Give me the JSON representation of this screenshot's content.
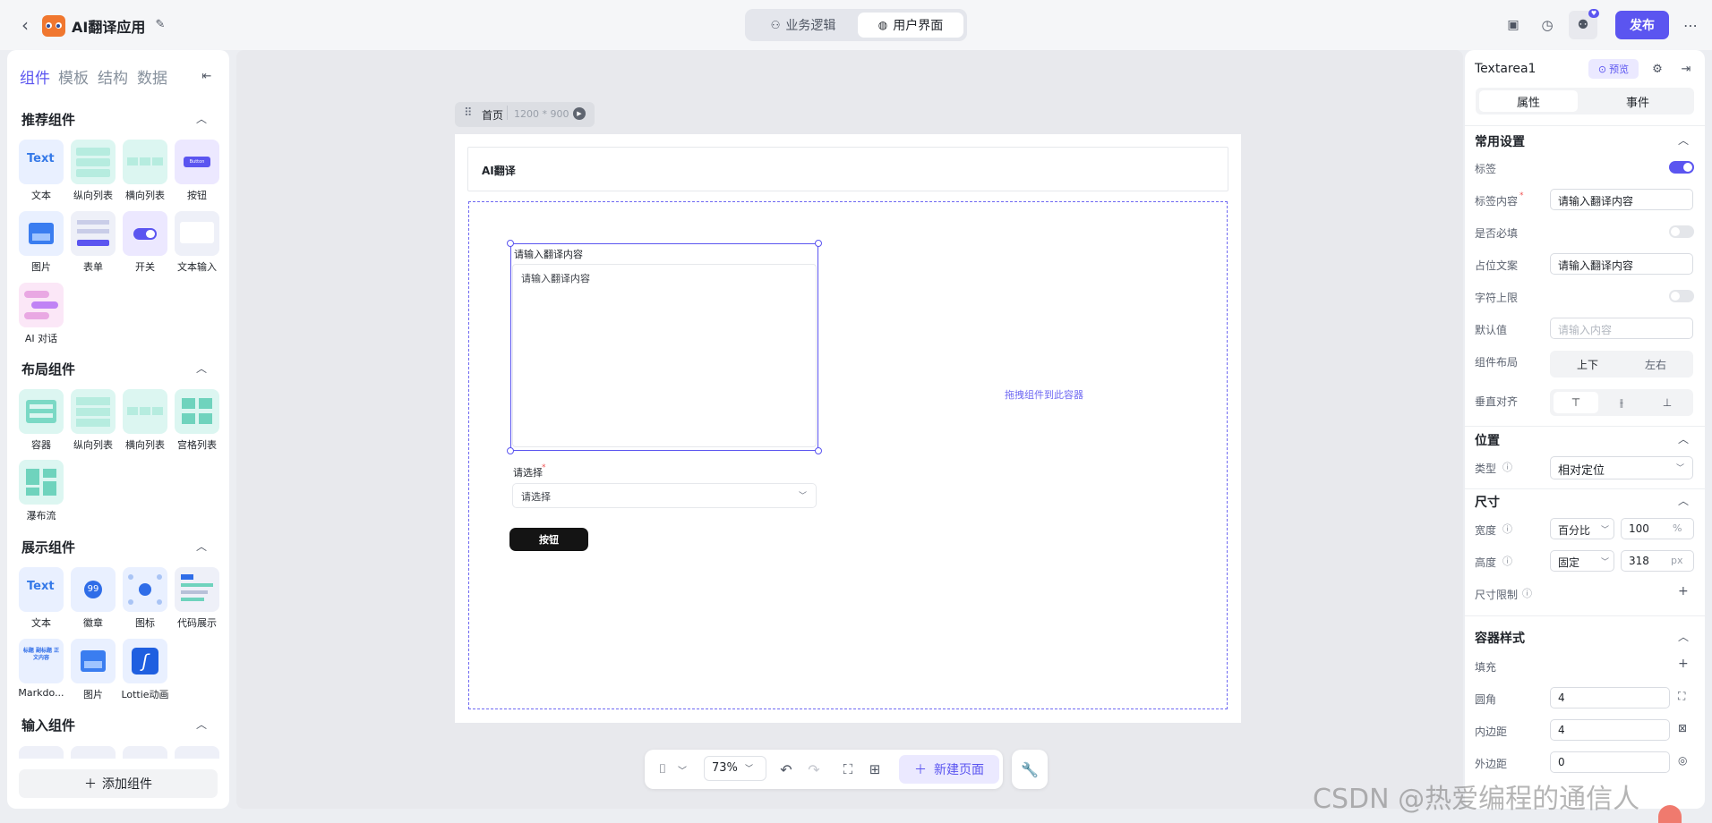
{
  "app": {
    "title": "AI翻译应用"
  },
  "header": {
    "tabs": [
      {
        "label": "业务逻辑"
      },
      {
        "label": "用户界面"
      }
    ],
    "publish_label": "发布",
    "badge": "♥"
  },
  "sidebar": {
    "categories": [
      "组件",
      "模板",
      "结构",
      "数据"
    ],
    "sections": {
      "recommended": "推荐组件",
      "layout": "布局组件",
      "display": "展示组件",
      "input": "输入组件"
    },
    "recommended": [
      "文本",
      "纵向列表",
      "横向列表",
      "按钮",
      "图片",
      "表单",
      "开关",
      "文本输入",
      "AI 对话"
    ],
    "layout": [
      "容器",
      "纵向列表",
      "横向列表",
      "宫格列表",
      "瀑布流"
    ],
    "display": [
      "文本",
      "徽章",
      "图标",
      "代码展示",
      "Markdo...",
      "图片",
      "Lottie动画"
    ],
    "thumb_text": {
      "text": "Text",
      "badge": "99",
      "button": "Button",
      "md": "标题 副标题 正文内容"
    },
    "add_label": "添加组件"
  },
  "canvas": {
    "page_name": "首页",
    "page_size": "1200 * 900",
    "title": "AI翻译",
    "textarea_label": "请输入翻译内容",
    "textarea_placeholder": "请输入翻译内容",
    "select_label": "请选择",
    "select_placeholder": "请选择",
    "required_mark": "*",
    "button_label": "按钮",
    "drop_hint": "拖拽组件到此容器",
    "zoom": "73%",
    "new_page": "新建页面"
  },
  "props": {
    "component": "Textarea1",
    "preview": "预览",
    "tabs": [
      "属性",
      "事件"
    ],
    "common": {
      "title": "常用设置",
      "label": "标签",
      "label_content": "标签内容",
      "label_content_value": "请输入翻译内容",
      "required": "是否必填",
      "placeholder": "占位文案",
      "placeholder_value": "请输入翻译内容",
      "maxlen": "字符上限",
      "default": "默认值",
      "default_ph": "请输入内容",
      "layout": "组件布局",
      "layout_opts": [
        "上下",
        "左右"
      ],
      "valign": "垂直对齐",
      "label_on": true,
      "required_on": false,
      "maxlen_on": false
    },
    "position": {
      "title": "位置",
      "type_label": "类型",
      "type_value": "相对定位"
    },
    "size": {
      "title": "尺寸",
      "width_label": "宽度",
      "width_mode": "百分比",
      "width_value": "100",
      "width_unit": "%",
      "height_label": "高度",
      "height_mode": "固定",
      "height_value": "318",
      "height_unit": "px",
      "limit_label": "尺寸限制"
    },
    "style": {
      "title": "容器样式",
      "fill": "填充",
      "radius": "圆角",
      "radius_value": "4",
      "padding": "内边距",
      "padding_value": "4",
      "margin": "外边距",
      "margin_value": "0"
    }
  },
  "watermark": "CSDN @热爱编程的通信人",
  "colors": {
    "accent": "#5b55f0",
    "dark_button": "#141414",
    "canvas_bg": "#e8e9ed"
  }
}
